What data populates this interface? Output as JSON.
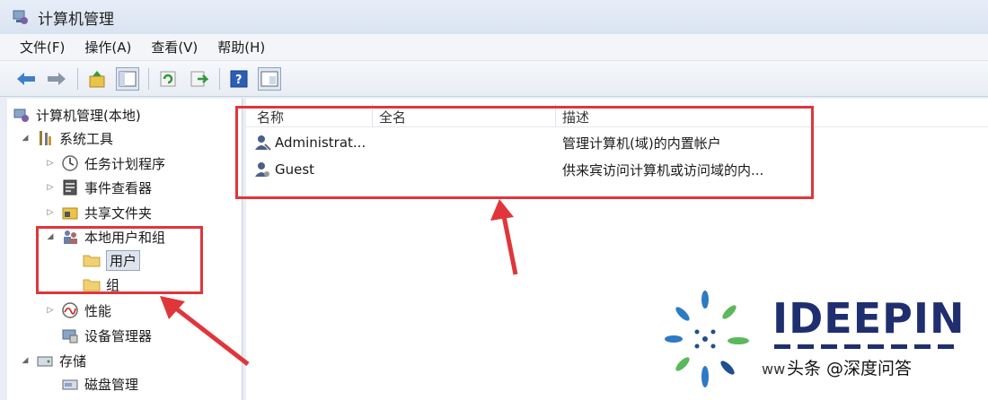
{
  "window": {
    "title": "计算机管理"
  },
  "menu": [
    "文件(F)",
    "操作(A)",
    "查看(V)",
    "帮助(H)"
  ],
  "toolbar": [
    "back-icon",
    "forward-icon",
    "up-icon",
    "show-tree-icon",
    "refresh-icon",
    "export-icon",
    "help-icon",
    "properties-icon"
  ],
  "tree": {
    "root": "计算机管理(本地)",
    "system_tools": "系统工具",
    "task_scheduler": "任务计划程序",
    "event_viewer": "事件查看器",
    "shared_folders": "共享文件夹",
    "local_users": "本地用户和组",
    "users": "用户",
    "groups": "组",
    "performance": "性能",
    "device_manager": "设备管理器",
    "storage": "存储",
    "disk_management": "磁盘管理"
  },
  "list": {
    "columns": [
      "名称",
      "全名",
      "描述"
    ],
    "rows": [
      {
        "name": "Administrat...",
        "full_name": "",
        "description": "管理计算机(域)的内置帐户"
      },
      {
        "name": "Guest",
        "full_name": "",
        "description": "供来宾访问计算机或访问域的内..."
      }
    ]
  },
  "watermark": {
    "brand": "IDEEPIN",
    "caption": "头条 @深度问答",
    "url_fragment": "ww"
  },
  "colors": {
    "highlight_box": "#e0363b",
    "brand": "#1f2e6e"
  }
}
